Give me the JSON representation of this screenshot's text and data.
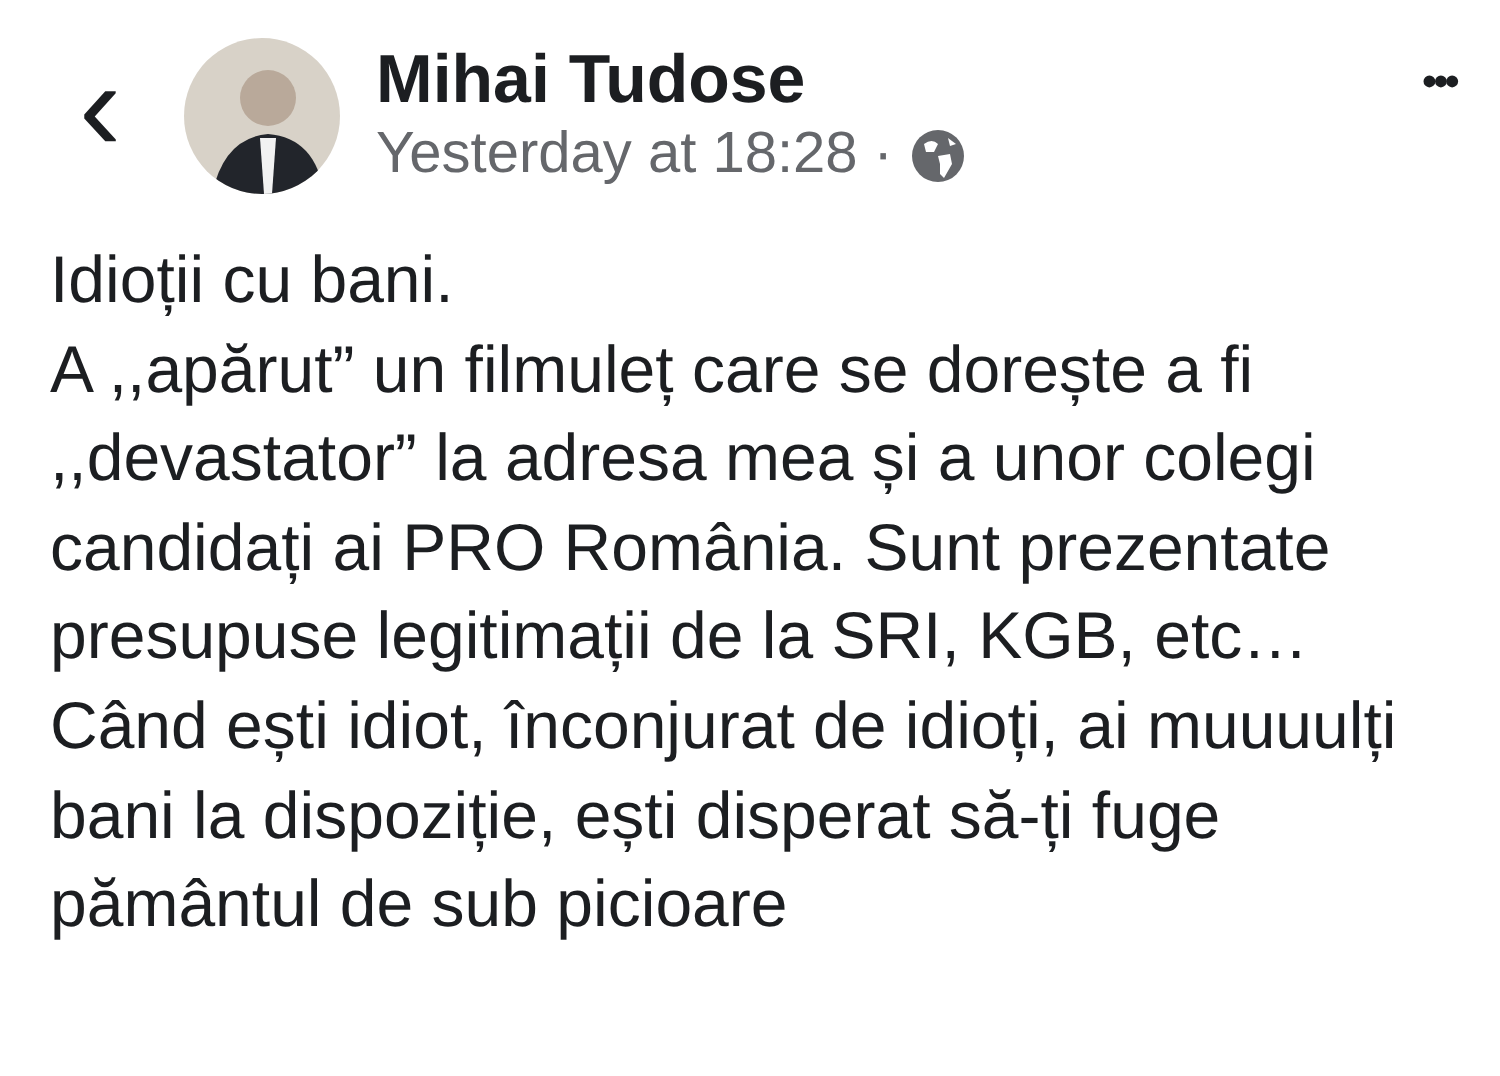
{
  "header": {
    "back": "‹",
    "author": "Mihai Tudose",
    "time": "Yesterday at 18:28",
    "separator": "·",
    "more": "•••"
  },
  "post": {
    "paragraphs": [
      "Idioții cu bani.",
      "A ,,apărut” un filmuleț care se dorește a fi ,,devastator” la adresa mea și a unor colegi candidați ai PRO România. Sunt prezentate presupuse legitimații de la SRI, KGB, etc…",
      "Când ești idiot, înconjurat de idioți, ai muuuulți bani la dispoziție, ești disperat să-ți fuge pământul de sub picioare"
    ]
  }
}
